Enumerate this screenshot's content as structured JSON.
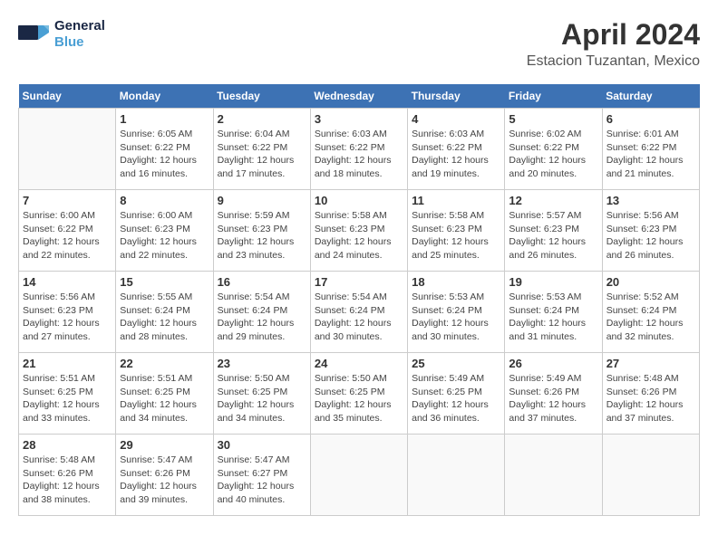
{
  "logo": {
    "line1": "General",
    "line2": "Blue"
  },
  "title": "April 2024",
  "location": "Estacion Tuzantan, Mexico",
  "days_of_week": [
    "Sunday",
    "Monday",
    "Tuesday",
    "Wednesday",
    "Thursday",
    "Friday",
    "Saturday"
  ],
  "weeks": [
    [
      {
        "day": "",
        "info": ""
      },
      {
        "day": "1",
        "info": "Sunrise: 6:05 AM\nSunset: 6:22 PM\nDaylight: 12 hours\nand 16 minutes."
      },
      {
        "day": "2",
        "info": "Sunrise: 6:04 AM\nSunset: 6:22 PM\nDaylight: 12 hours\nand 17 minutes."
      },
      {
        "day": "3",
        "info": "Sunrise: 6:03 AM\nSunset: 6:22 PM\nDaylight: 12 hours\nand 18 minutes."
      },
      {
        "day": "4",
        "info": "Sunrise: 6:03 AM\nSunset: 6:22 PM\nDaylight: 12 hours\nand 19 minutes."
      },
      {
        "day": "5",
        "info": "Sunrise: 6:02 AM\nSunset: 6:22 PM\nDaylight: 12 hours\nand 20 minutes."
      },
      {
        "day": "6",
        "info": "Sunrise: 6:01 AM\nSunset: 6:22 PM\nDaylight: 12 hours\nand 21 minutes."
      }
    ],
    [
      {
        "day": "7",
        "info": "Sunrise: 6:00 AM\nSunset: 6:22 PM\nDaylight: 12 hours\nand 22 minutes."
      },
      {
        "day": "8",
        "info": "Sunrise: 6:00 AM\nSunset: 6:23 PM\nDaylight: 12 hours\nand 22 minutes."
      },
      {
        "day": "9",
        "info": "Sunrise: 5:59 AM\nSunset: 6:23 PM\nDaylight: 12 hours\nand 23 minutes."
      },
      {
        "day": "10",
        "info": "Sunrise: 5:58 AM\nSunset: 6:23 PM\nDaylight: 12 hours\nand 24 minutes."
      },
      {
        "day": "11",
        "info": "Sunrise: 5:58 AM\nSunset: 6:23 PM\nDaylight: 12 hours\nand 25 minutes."
      },
      {
        "day": "12",
        "info": "Sunrise: 5:57 AM\nSunset: 6:23 PM\nDaylight: 12 hours\nand 26 minutes."
      },
      {
        "day": "13",
        "info": "Sunrise: 5:56 AM\nSunset: 6:23 PM\nDaylight: 12 hours\nand 26 minutes."
      }
    ],
    [
      {
        "day": "14",
        "info": "Sunrise: 5:56 AM\nSunset: 6:23 PM\nDaylight: 12 hours\nand 27 minutes."
      },
      {
        "day": "15",
        "info": "Sunrise: 5:55 AM\nSunset: 6:24 PM\nDaylight: 12 hours\nand 28 minutes."
      },
      {
        "day": "16",
        "info": "Sunrise: 5:54 AM\nSunset: 6:24 PM\nDaylight: 12 hours\nand 29 minutes."
      },
      {
        "day": "17",
        "info": "Sunrise: 5:54 AM\nSunset: 6:24 PM\nDaylight: 12 hours\nand 30 minutes."
      },
      {
        "day": "18",
        "info": "Sunrise: 5:53 AM\nSunset: 6:24 PM\nDaylight: 12 hours\nand 30 minutes."
      },
      {
        "day": "19",
        "info": "Sunrise: 5:53 AM\nSunset: 6:24 PM\nDaylight: 12 hours\nand 31 minutes."
      },
      {
        "day": "20",
        "info": "Sunrise: 5:52 AM\nSunset: 6:24 PM\nDaylight: 12 hours\nand 32 minutes."
      }
    ],
    [
      {
        "day": "21",
        "info": "Sunrise: 5:51 AM\nSunset: 6:25 PM\nDaylight: 12 hours\nand 33 minutes."
      },
      {
        "day": "22",
        "info": "Sunrise: 5:51 AM\nSunset: 6:25 PM\nDaylight: 12 hours\nand 34 minutes."
      },
      {
        "day": "23",
        "info": "Sunrise: 5:50 AM\nSunset: 6:25 PM\nDaylight: 12 hours\nand 34 minutes."
      },
      {
        "day": "24",
        "info": "Sunrise: 5:50 AM\nSunset: 6:25 PM\nDaylight: 12 hours\nand 35 minutes."
      },
      {
        "day": "25",
        "info": "Sunrise: 5:49 AM\nSunset: 6:25 PM\nDaylight: 12 hours\nand 36 minutes."
      },
      {
        "day": "26",
        "info": "Sunrise: 5:49 AM\nSunset: 6:26 PM\nDaylight: 12 hours\nand 37 minutes."
      },
      {
        "day": "27",
        "info": "Sunrise: 5:48 AM\nSunset: 6:26 PM\nDaylight: 12 hours\nand 37 minutes."
      }
    ],
    [
      {
        "day": "28",
        "info": "Sunrise: 5:48 AM\nSunset: 6:26 PM\nDaylight: 12 hours\nand 38 minutes."
      },
      {
        "day": "29",
        "info": "Sunrise: 5:47 AM\nSunset: 6:26 PM\nDaylight: 12 hours\nand 39 minutes."
      },
      {
        "day": "30",
        "info": "Sunrise: 5:47 AM\nSunset: 6:27 PM\nDaylight: 12 hours\nand 40 minutes."
      },
      {
        "day": "",
        "info": ""
      },
      {
        "day": "",
        "info": ""
      },
      {
        "day": "",
        "info": ""
      },
      {
        "day": "",
        "info": ""
      }
    ]
  ]
}
